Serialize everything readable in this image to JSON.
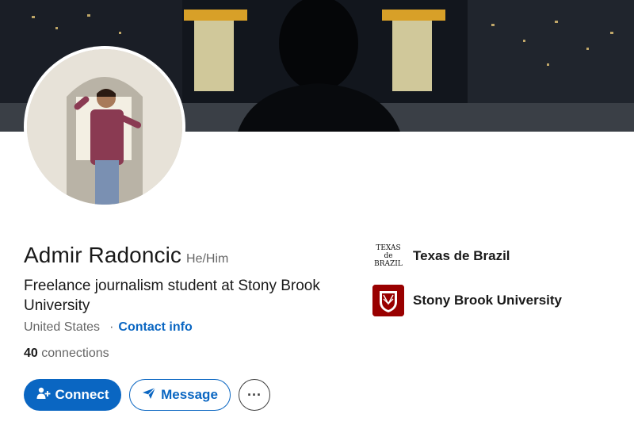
{
  "profile": {
    "name": "Admir Radoncic",
    "pronouns": "He/Him",
    "headline": "Freelance journalism student at Stony Brook University",
    "location": "United States",
    "separator": "·",
    "contact_info": "Contact info",
    "connections_count": "40",
    "connections_label": "connections"
  },
  "actions": {
    "connect": "Connect",
    "message": "Message",
    "more": "···"
  },
  "organizations": [
    {
      "name": "Texas de Brazil",
      "logo_text": "TEXAS de BRAZIL",
      "icon": "texas-de-brazil-logo"
    },
    {
      "name": "Stony Brook University",
      "icon": "stony-brook-university-logo"
    }
  ],
  "colors": {
    "primary": "#0a66c2",
    "text": "#191919",
    "muted": "#666666",
    "sbu_red": "#990000"
  }
}
